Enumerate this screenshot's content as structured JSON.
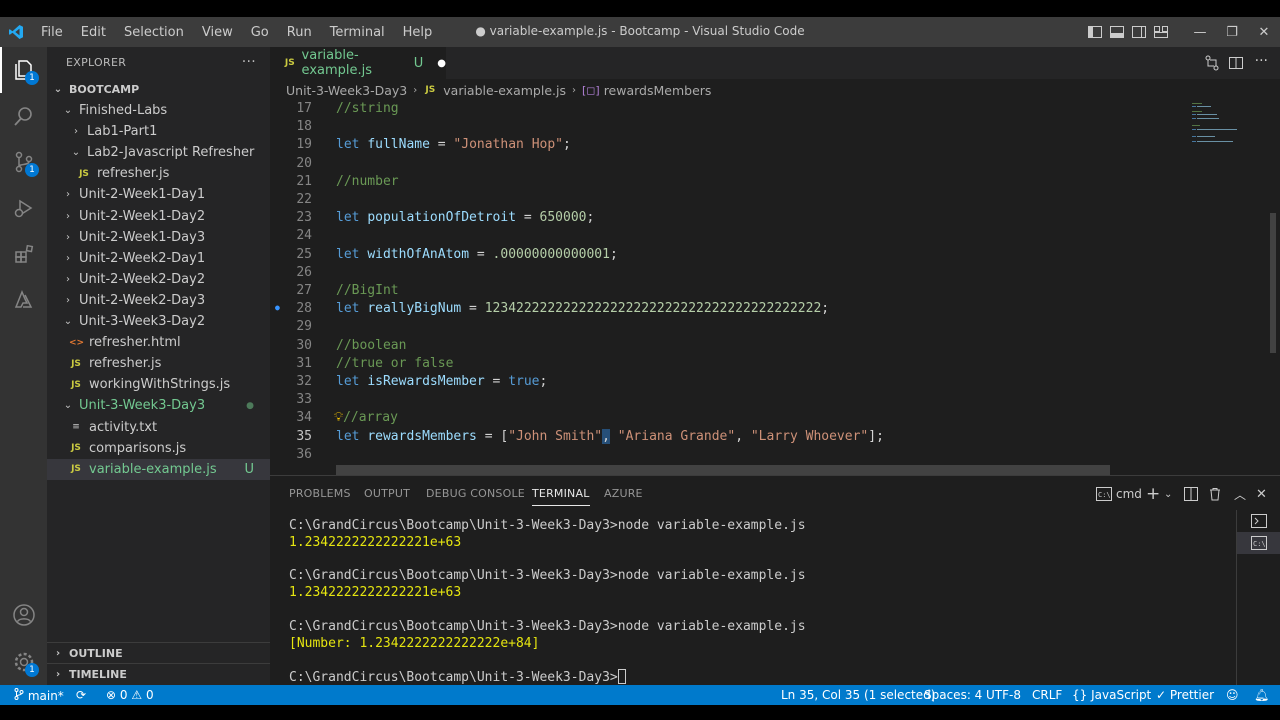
{
  "window": {
    "title": "● variable-example.js - Bootcamp - Visual Studio Code",
    "menu": [
      "File",
      "Edit",
      "Selection",
      "View",
      "Go",
      "Run",
      "Terminal",
      "Help"
    ]
  },
  "activity": {
    "source_control_badge": "1",
    "explorer_badge": "1",
    "settings_badge": "1"
  },
  "sidebar": {
    "header": "EXPLORER",
    "more": "···",
    "root": "BOOTCAMP",
    "tree": [
      {
        "label": "Finished-Labs",
        "kind": "folder-open"
      },
      {
        "label": "Lab1-Part1",
        "kind": "folder"
      },
      {
        "label": "Lab2-Javascript Refresher",
        "kind": "folder-open"
      },
      {
        "label": "refresher.js",
        "kind": "js"
      },
      {
        "label": "Unit-2-Week1-Day1",
        "kind": "folder"
      },
      {
        "label": "Unit-2-Week1-Day2",
        "kind": "folder"
      },
      {
        "label": "Unit-2-Week1-Day3",
        "kind": "folder"
      },
      {
        "label": "Unit-2-Week2-Day1",
        "kind": "folder"
      },
      {
        "label": "Unit-2-Week2-Day2",
        "kind": "folder"
      },
      {
        "label": "Unit-2-Week2-Day3",
        "kind": "folder"
      },
      {
        "label": "Unit-3-Week3-Day2",
        "kind": "folder-open"
      },
      {
        "label": "refresher.html",
        "kind": "html"
      },
      {
        "label": "refresher.js",
        "kind": "js"
      },
      {
        "label": "workingWithStrings.js",
        "kind": "js"
      },
      {
        "label": "Unit-3-Week3-Day3",
        "kind": "folder-open"
      },
      {
        "label": "activity.txt",
        "kind": "txt"
      },
      {
        "label": "comparisons.js",
        "kind": "js"
      },
      {
        "label": "variable-example.js",
        "kind": "js",
        "status": "U"
      }
    ],
    "outline": "OUTLINE",
    "timeline": "TIMELINE"
  },
  "tab": {
    "label": "variable-example.js",
    "status": "U"
  },
  "breadcrumb": {
    "folder": "Unit-3-Week3-Day3",
    "file": "variable-example.js",
    "symbol": "rewardsMembers"
  },
  "code": {
    "lines": [
      {
        "n": "17",
        "t": "//string"
      },
      {
        "n": "18",
        "t": ""
      },
      {
        "n": "19",
        "kw": "let",
        "var": "fullName",
        "op": " = ",
        "str": "\"Jonathan Hop\"",
        "end": ";"
      },
      {
        "n": "20",
        "t": ""
      },
      {
        "n": "21",
        "t": "//number"
      },
      {
        "n": "22",
        "t": ""
      },
      {
        "n": "23",
        "kw": "let",
        "var": "populationOfDetroit",
        "op": " = ",
        "num": "650000",
        "end": ";"
      },
      {
        "n": "24",
        "t": ""
      },
      {
        "n": "25",
        "kw": "let",
        "var": "widthOfAnAtom",
        "op": " = ",
        "num": ".00000000000001",
        "end": ";"
      },
      {
        "n": "26",
        "t": ""
      },
      {
        "n": "27",
        "t": "//BigInt"
      },
      {
        "n": "28",
        "kw": "let",
        "var": "reallyBigNum",
        "op": " = ",
        "num": "1234222222222222222222222222222222222222222",
        "end": ";"
      },
      {
        "n": "29",
        "t": ""
      },
      {
        "n": "30",
        "t": "//boolean"
      },
      {
        "n": "31",
        "t": "//true or false"
      },
      {
        "n": "32",
        "kw": "let",
        "var": "isRewardsMember",
        "op": " = ",
        "bool": "true",
        "end": ";"
      },
      {
        "n": "33",
        "t": ""
      },
      {
        "n": "34",
        "t": "//array"
      },
      {
        "n": "35",
        "kw": "let",
        "var": "rewardsMembers",
        "op": " = [",
        "s1": "\"John Smith\"",
        "c1": ",",
        "s2": " \"Ariana Grande\"",
        "c2": ",",
        "s3": " \"Larry Whoever\"",
        "end": "];"
      },
      {
        "n": "36",
        "t": ""
      }
    ]
  },
  "panel": {
    "tabs": [
      "PROBLEMS",
      "OUTPUT",
      "DEBUG CONSOLE",
      "TERMINAL",
      "AZURE"
    ],
    "shell": "cmd",
    "terminal": [
      {
        "type": "cmd",
        "text": "C:\\GrandCircus\\Bootcamp\\Unit-3-Week3-Day3>node variable-example.js"
      },
      {
        "type": "out",
        "text": "1.2342222222222221e+63"
      },
      {
        "type": "blank",
        "text": ""
      },
      {
        "type": "cmd",
        "text": "C:\\GrandCircus\\Bootcamp\\Unit-3-Week3-Day3>node variable-example.js"
      },
      {
        "type": "out",
        "text": "1.2342222222222221e+63"
      },
      {
        "type": "blank",
        "text": ""
      },
      {
        "type": "cmd",
        "text": "C:\\GrandCircus\\Bootcamp\\Unit-3-Week3-Day3>node variable-example.js"
      },
      {
        "type": "out",
        "text": "[Number: 1.2342222222222222e+84]"
      },
      {
        "type": "blank",
        "text": ""
      },
      {
        "type": "prompt",
        "text": "C:\\GrandCircus\\Bootcamp\\Unit-3-Week3-Day3>"
      }
    ]
  },
  "status": {
    "branch": "main*",
    "errors": "0",
    "warnings": "0",
    "position": "Ln 35, Col 35 (1 selected)",
    "spaces": "Spaces: 4",
    "encoding": "UTF-8",
    "eol": "CRLF",
    "language": "JavaScript",
    "formatter": "Prettier"
  },
  "colors": {
    "accent": "#007acc",
    "untracked": "#73c991",
    "js_icon": "#cbcb41"
  }
}
